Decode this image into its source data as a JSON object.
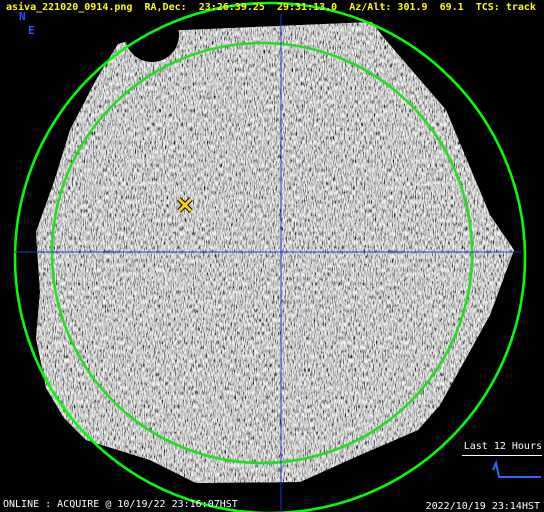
{
  "header": {
    "filename": "asiva_221020_0914.png",
    "radec_label": "RA,Dec:",
    "ra": "23:26:39.25",
    "dec": "29:31:13.0",
    "azalt_label": "Az/Alt:",
    "az": "301.9",
    "alt": "69.1",
    "tcs_label": "TCS:",
    "tcs_state": "track"
  },
  "compass": {
    "north": "N",
    "east": "E"
  },
  "footer": {
    "status": "ONLINE : ACQUIRE @ 10/19/22 23:16:07HST",
    "timestamp": "2022/10/19 23:14HST",
    "history_label": "Last 12 Hours"
  },
  "overlay": {
    "horizon_color": "#00ff00",
    "limit_color": "#22dd22",
    "crosshair_color": "#2233dd",
    "target_color": "#ffd21f",
    "trend_color": "#2a6bff"
  },
  "icons": {
    "target_marker": "x-target-icon",
    "trend_chart": "sparkline-icon"
  }
}
